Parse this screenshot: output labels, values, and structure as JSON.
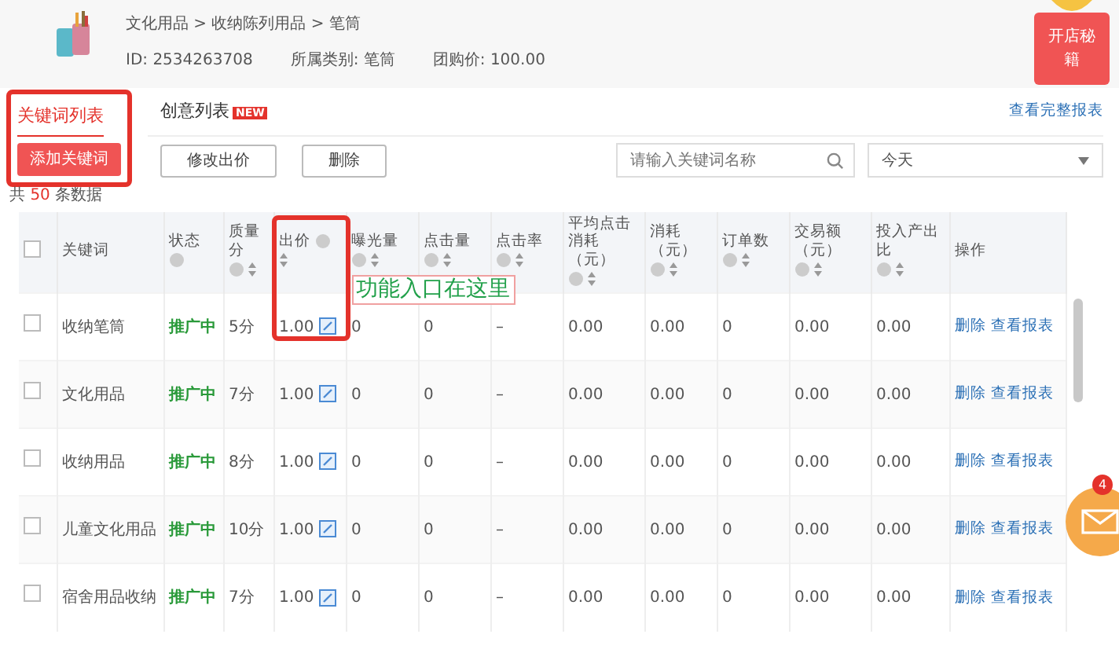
{
  "product": {
    "breadcrumb": "文化用品 > 收纳陈列用品 > 笔筒",
    "fields": [
      {
        "label": "ID:",
        "value": "2534263708"
      },
      {
        "label": "所属类别:",
        "value": "笔筒"
      },
      {
        "label": "团购价:",
        "value": "100.00"
      }
    ]
  },
  "promo_button": "开店秘籍",
  "tabs": [
    {
      "label": "关键词列表",
      "selected": true
    },
    {
      "label": "创意列表",
      "selected": false,
      "badge": "NEW"
    }
  ],
  "report_link": "查看完整报表",
  "buttons": [
    {
      "label": "添加关键词",
      "kind": "primary"
    },
    {
      "label": "修改出价",
      "kind": "default"
    },
    {
      "label": "删除",
      "kind": "default"
    }
  ],
  "search": {
    "placeholder": "请输入关键词名称"
  },
  "date_select": {
    "value": "今天"
  },
  "total": {
    "prefix": "共",
    "count": "50",
    "suffix": "条数据"
  },
  "table": {
    "select_all": {
      "checked": false
    },
    "columns": [
      {
        "label": "关键词",
        "help": false,
        "sortable": false
      },
      {
        "label": "状态",
        "help": true,
        "sortable": false
      },
      {
        "label": "质量分",
        "help": true,
        "sortable": true
      },
      {
        "label": "出价",
        "help": true,
        "sortable": true,
        "highlighted": true
      },
      {
        "label": "曝光量",
        "help": true,
        "sortable": true
      },
      {
        "label": "点击量",
        "help": true,
        "sortable": true
      },
      {
        "label": "点击率",
        "help": true,
        "sortable": true
      },
      {
        "label": "平均点击消耗（元）",
        "help": true,
        "sortable": true
      },
      {
        "label": "消耗（元）",
        "help": true,
        "sortable": true
      },
      {
        "label": "订单数",
        "help": true,
        "sortable": true
      },
      {
        "label": "交易额（元）",
        "help": true,
        "sortable": true
      },
      {
        "label": "投入产出比",
        "help": true,
        "sortable": true
      },
      {
        "label": "操作",
        "help": false,
        "sortable": false
      }
    ],
    "rows": [
      {
        "checked": false,
        "keyword": "收纳笔筒",
        "status": "推广中",
        "score": "5分",
        "bid": "1.00",
        "impressions": "0",
        "clicks": "0",
        "ctr": "–",
        "avg_cost": "0.00",
        "cost": "0.00",
        "orders": "0",
        "gmv": "0.00",
        "roi": "0.00",
        "actions": [
          "删除",
          "查看报表"
        ]
      },
      {
        "checked": false,
        "keyword": "文化用品",
        "status": "推广中",
        "score": "7分",
        "bid": "1.00",
        "impressions": "0",
        "clicks": "0",
        "ctr": "–",
        "avg_cost": "0.00",
        "cost": "0.00",
        "orders": "0",
        "gmv": "0.00",
        "roi": "0.00",
        "actions": [
          "删除",
          "查看报表"
        ]
      },
      {
        "checked": false,
        "keyword": "收纳用品",
        "status": "推广中",
        "score": "8分",
        "bid": "1.00",
        "impressions": "0",
        "clicks": "0",
        "ctr": "–",
        "avg_cost": "0.00",
        "cost": "0.00",
        "orders": "0",
        "gmv": "0.00",
        "roi": "0.00",
        "actions": [
          "删除",
          "查看报表"
        ]
      },
      {
        "checked": false,
        "keyword": "儿童文化用品",
        "status": "推广中",
        "score": "10分",
        "bid": "1.00",
        "impressions": "0",
        "clicks": "0",
        "ctr": "–",
        "avg_cost": "0.00",
        "cost": "0.00",
        "orders": "0",
        "gmv": "0.00",
        "roi": "0.00",
        "actions": [
          "删除",
          "查看报表"
        ]
      },
      {
        "checked": false,
        "keyword": "宿舍用品收纳",
        "status": "推广中",
        "score": "7分",
        "bid": "1.00",
        "impressions": "0",
        "clicks": "0",
        "ctr": "–",
        "avg_cost": "0.00",
        "cost": "0.00",
        "orders": "0",
        "gmv": "0.00",
        "roi": "0.00",
        "actions": [
          "删除",
          "查看报表"
        ]
      }
    ]
  },
  "annotation": "功能入口在这里",
  "mail_button": {
    "badge": "4"
  }
}
